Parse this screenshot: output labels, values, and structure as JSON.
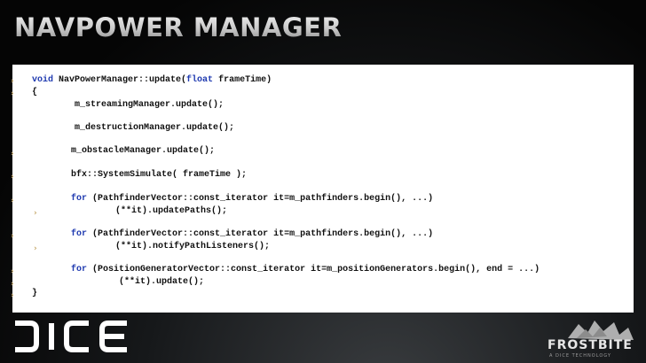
{
  "slide": {
    "title": "NAVPOWER MANAGER"
  },
  "code": {
    "lines": [
      [
        "void",
        " NavPowerManager::update(",
        "float",
        " frameTime)"
      ],
      [
        "",
        "{",
        "",
        ""
      ],
      [
        "",
        "        m_streamingManager.update();",
        "",
        ""
      ],
      [
        "",
        "        m_destructionManager.update();",
        "",
        ""
      ],
      [
        "",
        "        m_obstacleManager.update();",
        "",
        ""
      ],
      [
        "",
        "        bfx::SystemSimulate( frameTime );",
        "",
        ""
      ],
      [
        "",
        "        ",
        "for",
        " (PathfinderVector::const_iterator it=m_pathfinders.begin(), ...)"
      ],
      [
        "",
        "              (**it).updatePaths();",
        "",
        ""
      ],
      [
        "",
        "        ",
        "for",
        " (PathfinderVector::const_iterator it=m_pathfinders.begin(), ...)"
      ],
      [
        "",
        "              (**it).notifyPathListeners();",
        "",
        ""
      ],
      [
        "",
        "        ",
        "for",
        " (PositionGeneratorVector::const_iterator it=m_positionGenerators.begin(), end = ...)"
      ],
      [
        "",
        "              (**it).update();",
        "",
        ""
      ],
      [
        "",
        "}",
        "",
        ""
      ]
    ]
  },
  "logos": {
    "left_brand": "DICE",
    "right_brand": "FROSTBITE",
    "right_tagline": "A DICE TECHNOLOGY"
  },
  "colors": {
    "keyword": "#1f3ab0",
    "bullet": "#c6a86b",
    "panel": "#ffffff"
  }
}
